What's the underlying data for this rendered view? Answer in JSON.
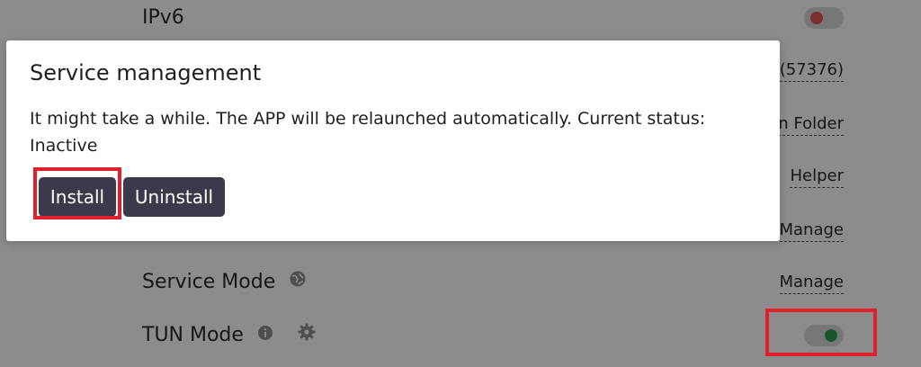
{
  "settings": {
    "ipv6": {
      "label": "IPv6",
      "toggle_state": "off"
    },
    "port": {
      "value_partial": "(57376)"
    },
    "folder": {
      "value_partial": "n Folder"
    },
    "helper": {
      "value_partial": "Helper"
    },
    "manage_hidden": {
      "value": "Manage"
    },
    "service_mode": {
      "label": "Service Mode",
      "value": "Manage",
      "icon": "globe-icon"
    },
    "tun_mode": {
      "label": "TUN Mode",
      "toggle_state": "on",
      "info_icon": "info-icon",
      "settings_icon": "gear-icon"
    }
  },
  "dialog": {
    "title": "Service management",
    "body": "It might take a while. The APP will be relaunched automatically. Current status: Inactive",
    "install_label": "Install",
    "uninstall_label": "Uninstall"
  },
  "colors": {
    "button_bg": "#3b3a4a",
    "toggle_off_knob": "#e05555",
    "toggle_on_knob": "#2e9d4f",
    "highlight": "#e0202a"
  }
}
